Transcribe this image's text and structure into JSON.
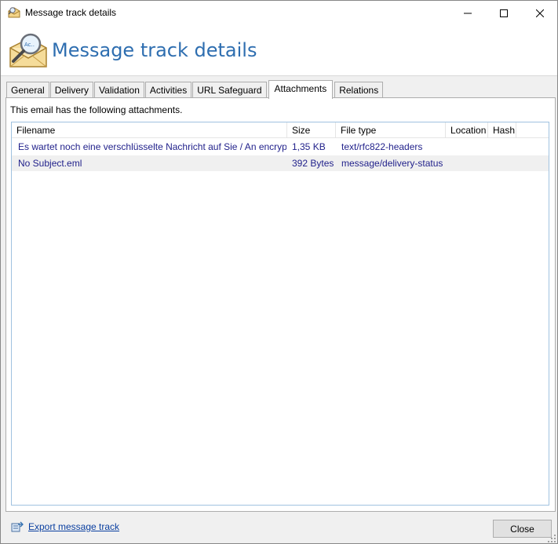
{
  "window": {
    "title": "Message track details",
    "controls": {
      "minimize": "minimize-icon",
      "maximize": "maximize-icon",
      "close": "close-icon"
    }
  },
  "header": {
    "title": "Message track details",
    "icon": "envelope-magnifier-icon",
    "accent_color": "#2e6eb0"
  },
  "tabs": [
    {
      "label": "General",
      "active": false
    },
    {
      "label": "Delivery",
      "active": false
    },
    {
      "label": "Validation",
      "active": false
    },
    {
      "label": "Activities",
      "active": false
    },
    {
      "label": "URL Safeguard",
      "active": false
    },
    {
      "label": "Attachments",
      "active": true
    },
    {
      "label": "Relations",
      "active": false
    }
  ],
  "attachments": {
    "intro": "This email has the following attachments.",
    "columns": [
      "Filename",
      "Size",
      "File type",
      "Location",
      "Hash"
    ],
    "rows": [
      {
        "filename": "Es wartet noch eine verschlüsselte Nachricht auf Sie / An encryp",
        "size": "1,35 KB",
        "file_type": "text/rfc822-headers",
        "location": "",
        "hash": ""
      },
      {
        "filename": "No Subject.eml",
        "size": "392 Bytes",
        "file_type": "message/delivery-status",
        "location": "",
        "hash": ""
      }
    ]
  },
  "footer": {
    "export_label": "Export message track",
    "export_icon": "export-icon",
    "close_label": "Close"
  }
}
